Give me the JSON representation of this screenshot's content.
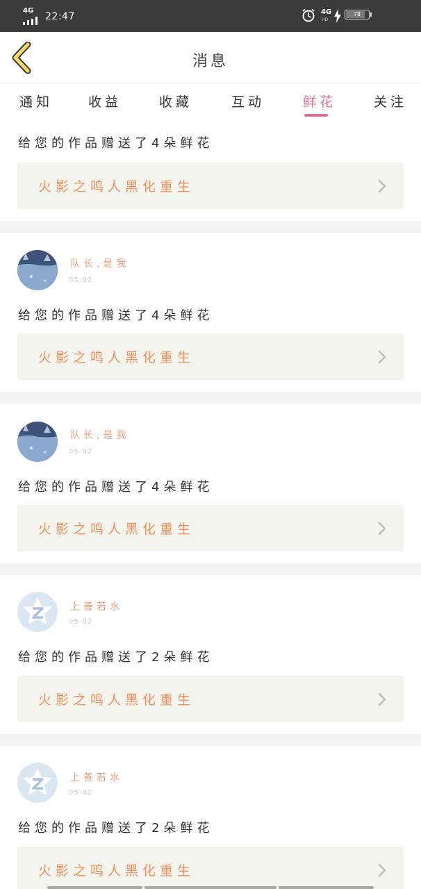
{
  "status_bar": {
    "network_left": "4G",
    "time": "22:47",
    "network_right": "4G",
    "network_right_sub": "HD",
    "battery": "78",
    "battery_level": 0.78
  },
  "header": {
    "title": "消息"
  },
  "tabs": [
    {
      "label": "通知",
      "active": false
    },
    {
      "label": "收益",
      "active": false
    },
    {
      "label": "收藏",
      "active": false
    },
    {
      "label": "互动",
      "active": false
    },
    {
      "label": "鲜花",
      "active": true
    },
    {
      "label": "关注",
      "active": false
    }
  ],
  "messages": [
    {
      "user": "",
      "date": "",
      "text": "给您的作品赠送了4朵鲜花",
      "work": "火影之鸣人黑化重生"
    },
    {
      "user": "队长,是我",
      "date": "05-02",
      "text": "给您的作品赠送了4朵鲜花",
      "work": "火影之鸣人黑化重生",
      "avatar": "photo-avatar"
    },
    {
      "user": "队长,是我",
      "date": "05-02",
      "text": "给您的作品赠送了4朵鲜花",
      "work": "火影之鸣人黑化重生",
      "avatar": "photo-avatar"
    },
    {
      "user": "上善若水",
      "date": "05-02",
      "text": "给您的作品赠送了2朵鲜花",
      "work": "火影之鸣人黑化重生",
      "avatar": "default-z-avatar"
    },
    {
      "user": "上善若水",
      "date": "05-02",
      "text": "给您的作品赠送了2朵鲜花",
      "work": "火影之鸣人黑化重生",
      "avatar": "default-z-avatar"
    }
  ],
  "colors": {
    "accent": "#e0709a",
    "user_name": "#e9a27e",
    "work_title": "#f0915e",
    "work_bg": "#f4f4ee"
  }
}
